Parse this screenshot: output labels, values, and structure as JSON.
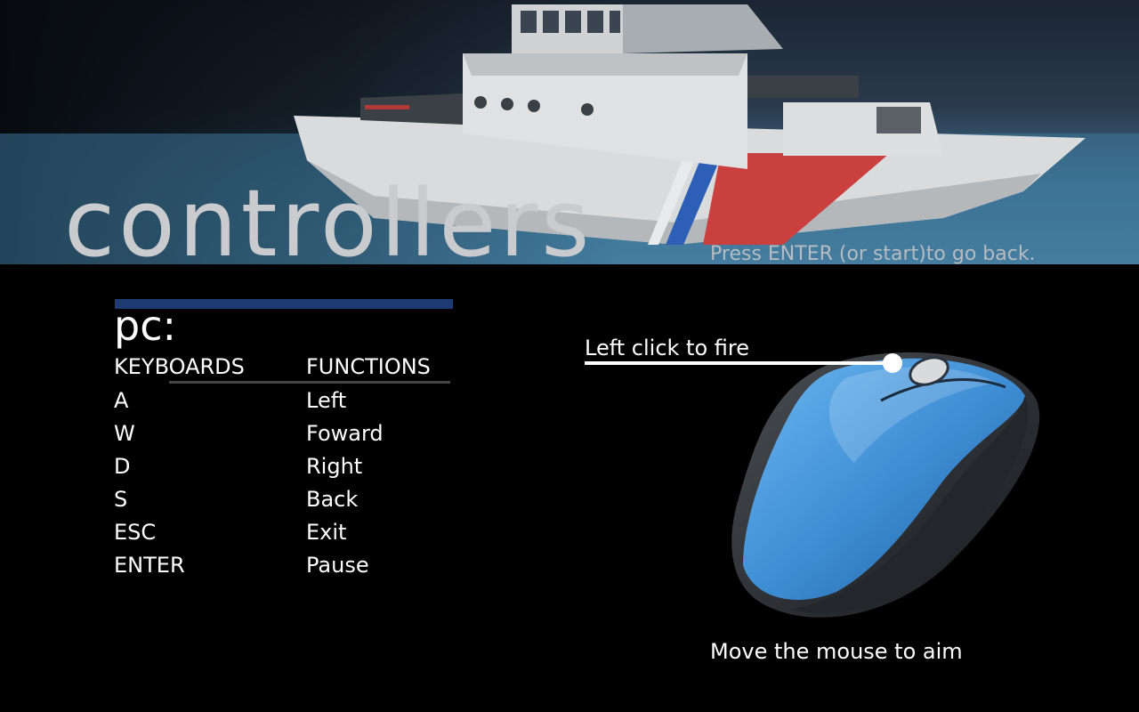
{
  "header": {
    "title": "controllers",
    "back_hint": "Press ENTER (or start)to go back."
  },
  "section": {
    "title": "pc:"
  },
  "controls": {
    "key_header": "KEYBOARDS",
    "function_header": "FUNCTIONS",
    "rows": [
      {
        "key": "A",
        "function": "Left"
      },
      {
        "key": "W",
        "function": "Foward"
      },
      {
        "key": "D",
        "function": "Right"
      },
      {
        "key": "S",
        "function": "Back"
      },
      {
        "key": "ESC",
        "function": "Exit"
      },
      {
        "key": "ENTER",
        "function": "Pause"
      }
    ]
  },
  "mouse": {
    "fire_label": "Left click to fire",
    "aim_label": "Move the mouse to aim"
  },
  "colors": {
    "accent_bar": "#1d3a73",
    "mouse_blue": "#3f8fd6"
  }
}
